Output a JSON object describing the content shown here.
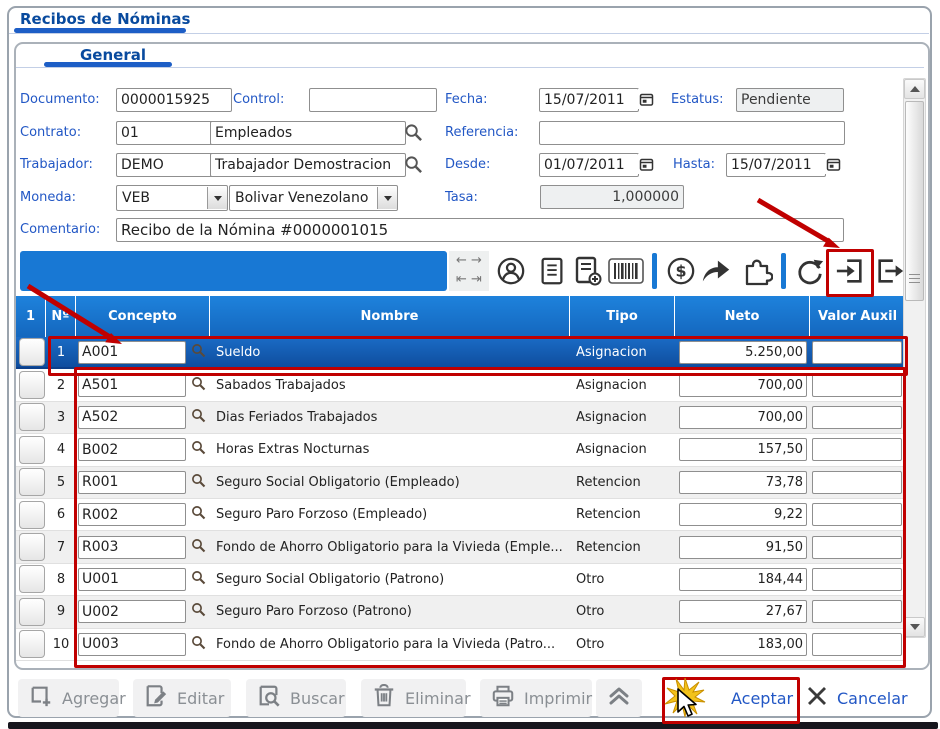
{
  "window": {
    "title": "Recibos de Nóminas"
  },
  "tab": {
    "label": "General"
  },
  "form": {
    "documento": {
      "label": "Documento:",
      "value": "0000015925"
    },
    "control": {
      "label": "Control:",
      "value": ""
    },
    "fecha": {
      "label": "Fecha:",
      "value": "15/07/2011"
    },
    "estatus": {
      "label": "Estatus:",
      "value": "Pendiente"
    },
    "contrato": {
      "label": "Contrato:",
      "code": "01",
      "name": "Empleados"
    },
    "referencia": {
      "label": "Referencia:",
      "value": ""
    },
    "trabajador": {
      "label": "Trabajador:",
      "code": "DEMO",
      "name": "Trabajador Demostracion"
    },
    "desde": {
      "label": "Desde:",
      "value": "01/07/2011"
    },
    "hasta": {
      "label": "Hasta:",
      "value": "15/07/2011"
    },
    "moneda": {
      "label": "Moneda:",
      "code": "VEB",
      "name": "Bolivar Venezolano"
    },
    "tasa": {
      "label": "Tasa:",
      "value": "1,000000"
    },
    "comentario": {
      "label": "Comentario:",
      "value": "Recibo de la Nómina #0000001015"
    }
  },
  "toolbar": {
    "icons": [
      "record-nav-arrows",
      "user",
      "document",
      "document-add",
      "barcode",
      "currency-dollar",
      "forward",
      "plugin",
      "refresh",
      "import",
      "export"
    ],
    "highlighted_icon": "import"
  },
  "table": {
    "headers": [
      "1",
      "Nº",
      "Concepto",
      "Nombre",
      "Tipo",
      "Neto",
      "Valor Auxil"
    ],
    "rows": [
      {
        "num": "1",
        "concepto": "A001",
        "nombre": "Sueldo",
        "tipo": "Asignacion",
        "neto": "5.250,00",
        "valor_auxiliar": "",
        "selected": true
      },
      {
        "num": "2",
        "concepto": "A501",
        "nombre": "Sabados Trabajados",
        "tipo": "Asignacion",
        "neto": "700,00",
        "valor_auxiliar": ""
      },
      {
        "num": "3",
        "concepto": "A502",
        "nombre": "Dias Feriados Trabajados",
        "tipo": "Asignacion",
        "neto": "700,00",
        "valor_auxiliar": ""
      },
      {
        "num": "4",
        "concepto": "B002",
        "nombre": "Horas Extras Nocturnas",
        "tipo": "Asignacion",
        "neto": "157,50",
        "valor_auxiliar": ""
      },
      {
        "num": "5",
        "concepto": "R001",
        "nombre": "Seguro Social Obligatorio (Empleado)",
        "tipo": "Retencion",
        "neto": "73,78",
        "valor_auxiliar": ""
      },
      {
        "num": "6",
        "concepto": "R002",
        "nombre": "Seguro Paro Forzoso (Empleado)",
        "tipo": "Retencion",
        "neto": "9,22",
        "valor_auxiliar": ""
      },
      {
        "num": "7",
        "concepto": "R003",
        "nombre": "Fondo de Ahorro Obligatorio para la Vivieda (Emple...",
        "tipo": "Retencion",
        "neto": "91,50",
        "valor_auxiliar": ""
      },
      {
        "num": "8",
        "concepto": "U001",
        "nombre": "Seguro Social Obligatorio (Patrono)",
        "tipo": "Otro",
        "neto": "184,44",
        "valor_auxiliar": ""
      },
      {
        "num": "9",
        "concepto": "U002",
        "nombre": "Seguro Paro Forzoso (Patrono)",
        "tipo": "Otro",
        "neto": "27,67",
        "valor_auxiliar": ""
      },
      {
        "num": "10",
        "concepto": "U003",
        "nombre": "Fondo de Ahorro Obligatorio para la Vivieda (Patro...",
        "tipo": "Otro",
        "neto": "183,00",
        "valor_auxiliar": ""
      }
    ]
  },
  "buttons": {
    "agregar": "Agregar",
    "editar": "Editar",
    "buscar": "Buscar",
    "eliminar": "Eliminar",
    "imprimir": "Imprimir",
    "aceptar": "Aceptar",
    "cancelar": "Cancelar"
  },
  "colors": {
    "header_blue": "#1877d3",
    "selected_row_blue": "#0f4d9e",
    "tab_underline_blue": "#1d5ec6",
    "label_blue": "#2257c5",
    "toolbar_blue": "#1878d4",
    "annotation_red": "#c00000",
    "starburst_yellow": "#f2c21a"
  }
}
